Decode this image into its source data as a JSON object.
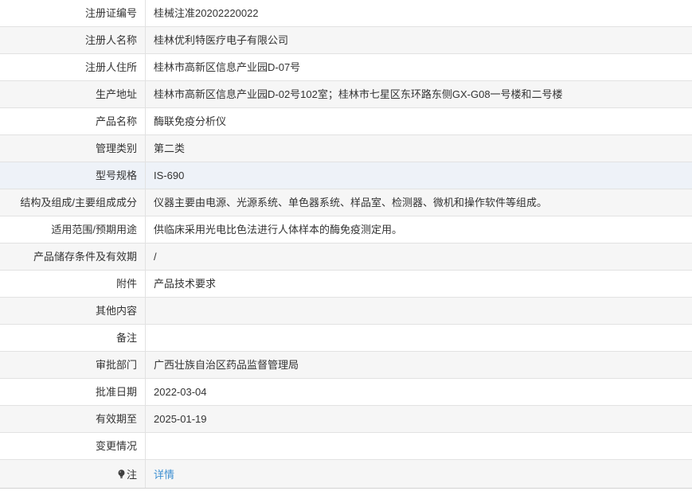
{
  "rows": [
    {
      "label": "注册证编号",
      "value": "桂械注准20202220022"
    },
    {
      "label": "注册人名称",
      "value": "桂林优利特医疗电子有限公司"
    },
    {
      "label": "注册人住所",
      "value": "桂林市高新区信息产业园D-07号"
    },
    {
      "label": "生产地址",
      "value": "桂林市高新区信息产业园D-02号102室；桂林市七星区东环路东侧GX-G08一号楼和二号楼"
    },
    {
      "label": "产品名称",
      "value": "酶联免疫分析仪"
    },
    {
      "label": "管理类别",
      "value": "第二类"
    },
    {
      "label": "型号规格",
      "value": "IS-690"
    },
    {
      "label": "结构及组成/主要组成成分",
      "value": "仪器主要由电源、光源系统、单色器系统、样品室、检测器、微机和操作软件等组成。"
    },
    {
      "label": "适用范围/预期用途",
      "value": "供临床采用光电比色法进行人体样本的酶免疫测定用。"
    },
    {
      "label": "产品储存条件及有效期",
      "value": "/"
    },
    {
      "label": "附件",
      "value": "产品技术要求"
    },
    {
      "label": "其他内容"
    },
    {
      "label": "备注"
    },
    {
      "label": "审批部门",
      "value": "广西壮族自治区药品监督管理局"
    },
    {
      "label": "批准日期",
      "value": "2022-03-04"
    },
    {
      "label": "有效期至",
      "value": "2025-01-19"
    },
    {
      "label": "变更情况"
    }
  ],
  "note": {
    "icon": "lightbulb-icon",
    "label": "注",
    "link_text": "详情"
  },
  "colors": {
    "link": "#3d8fd1",
    "row_alt": "#f6f6f6",
    "row_hover": "#eef2f8",
    "border": "#e2e2e2",
    "text": "#333333"
  }
}
